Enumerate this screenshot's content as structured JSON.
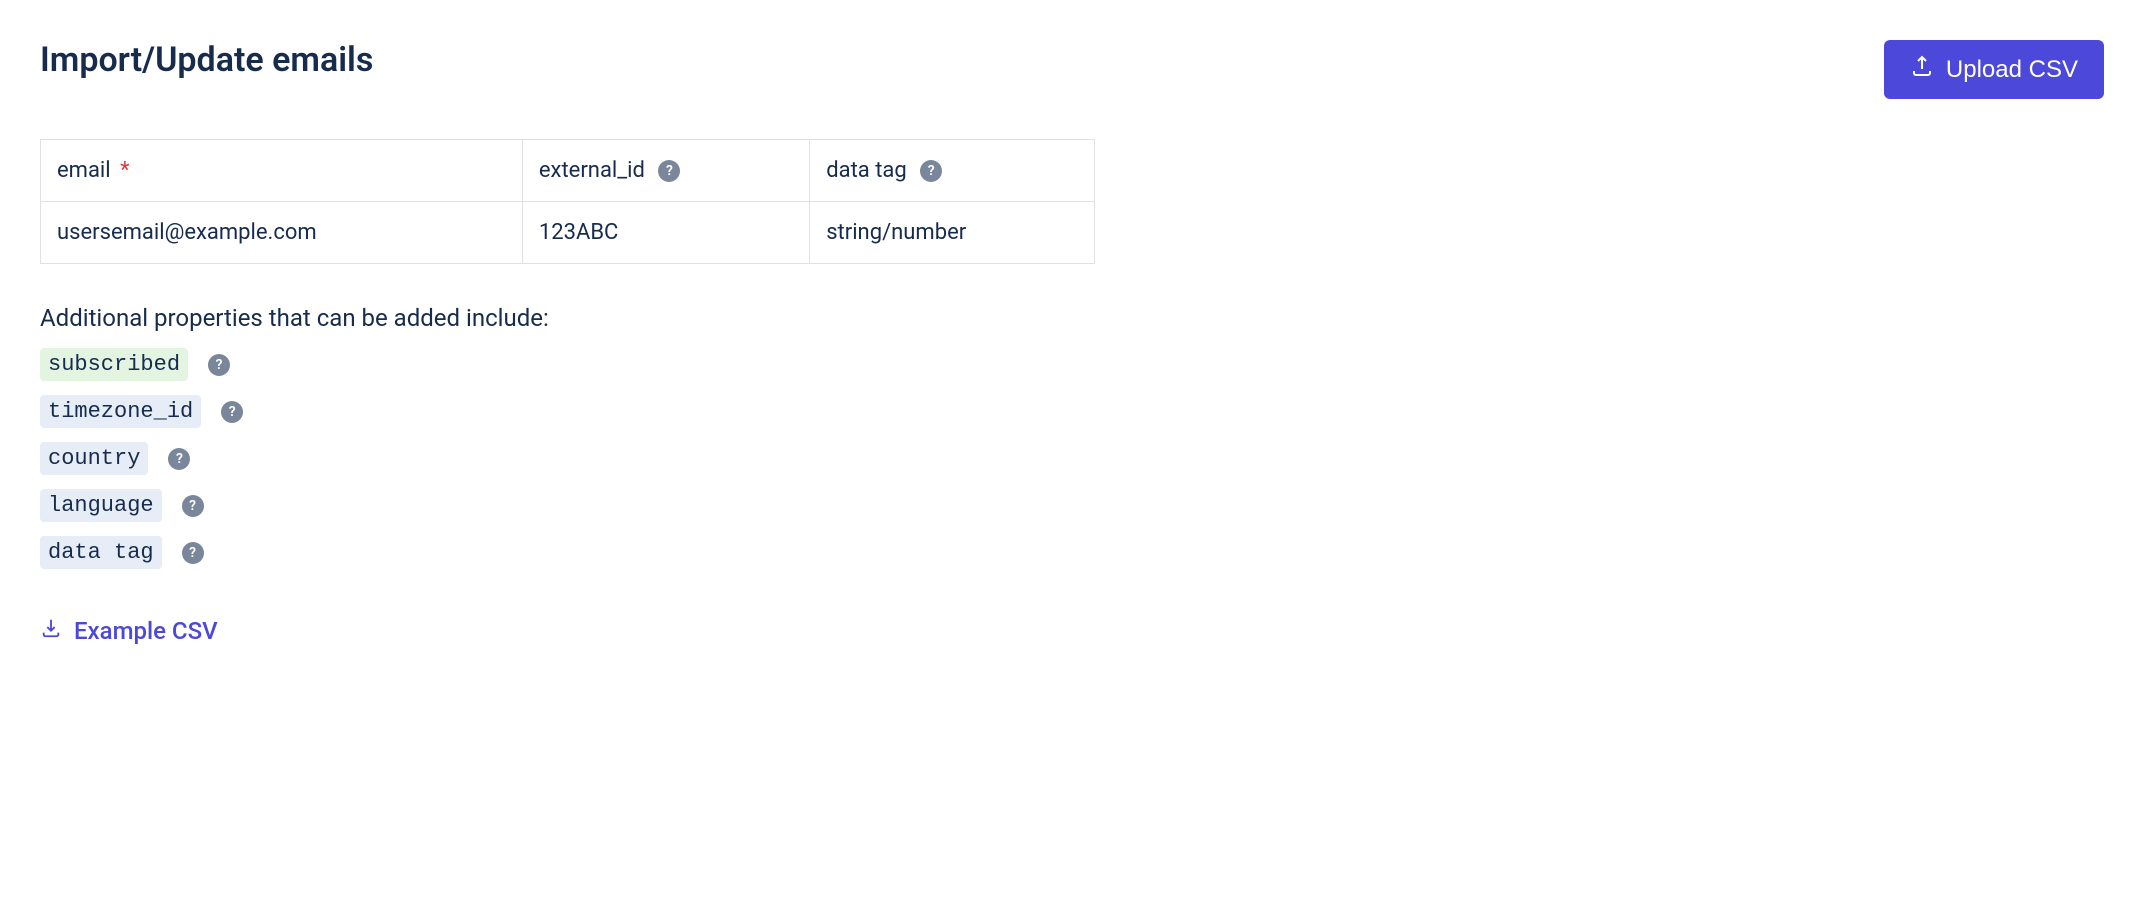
{
  "header": {
    "title": "Import/Update emails",
    "upload_label": "Upload CSV"
  },
  "table": {
    "headers": {
      "email": "email",
      "email_required": "*",
      "external_id": "external_id",
      "data_tag": "data tag"
    },
    "row": {
      "email": "usersemail@example.com",
      "external_id": "123ABC",
      "data_tag": "string/number"
    }
  },
  "additional": {
    "intro": "Additional properties that can be added include:",
    "props": [
      {
        "label": "subscribed",
        "variant": "green"
      },
      {
        "label": "timezone_id",
        "variant": "blue"
      },
      {
        "label": "country",
        "variant": "blue"
      },
      {
        "label": "language",
        "variant": "blue"
      },
      {
        "label": "data tag",
        "variant": "blue"
      }
    ]
  },
  "example_link": "Example CSV",
  "help_glyph": "?"
}
